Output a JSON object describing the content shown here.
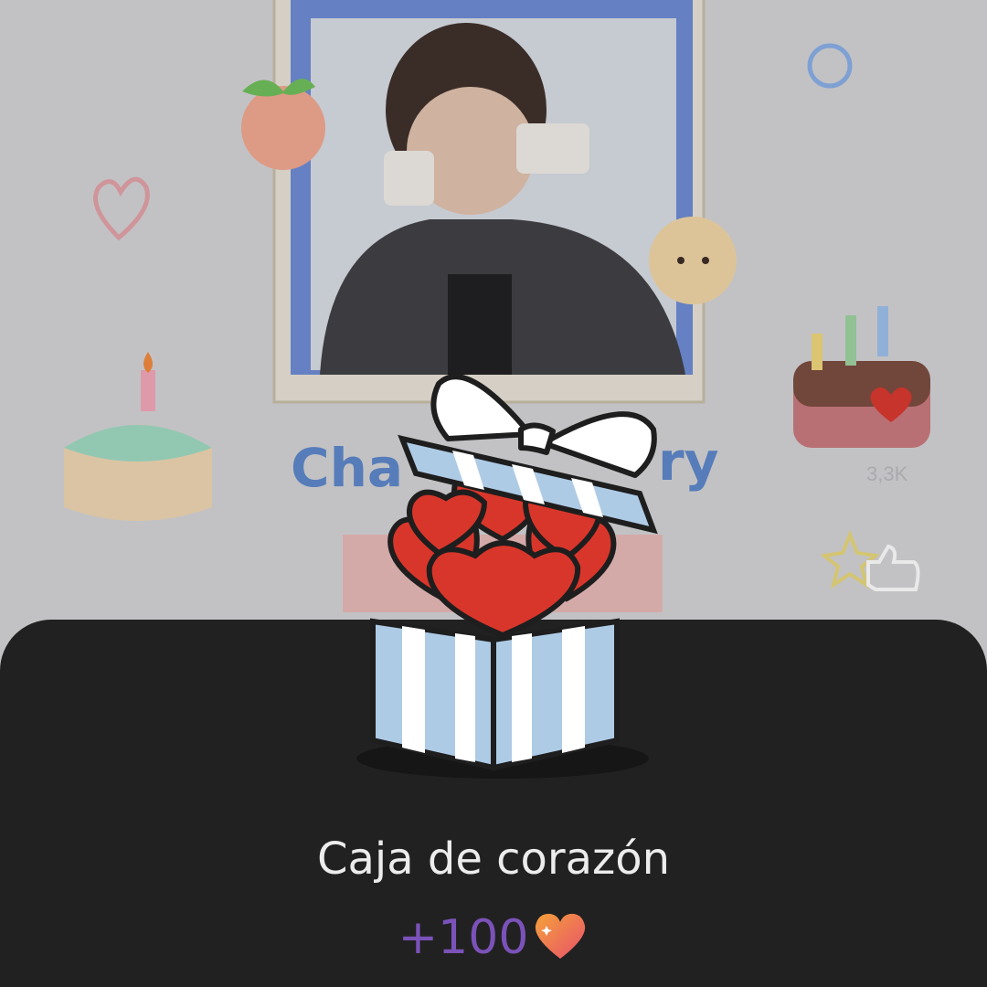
{
  "background": {
    "banner_text": "Cha ry",
    "like_count": "3,3K"
  },
  "popup": {
    "gift_name": "Caja de corazón",
    "reward_amount": "+100",
    "reward_icon": "heart-icon"
  },
  "colors": {
    "sheet": "#212121",
    "title_text": "#ececec",
    "reward_text": "#7b52b9",
    "heart_red": "#d9362b",
    "box_blue": "#aecbe6"
  }
}
